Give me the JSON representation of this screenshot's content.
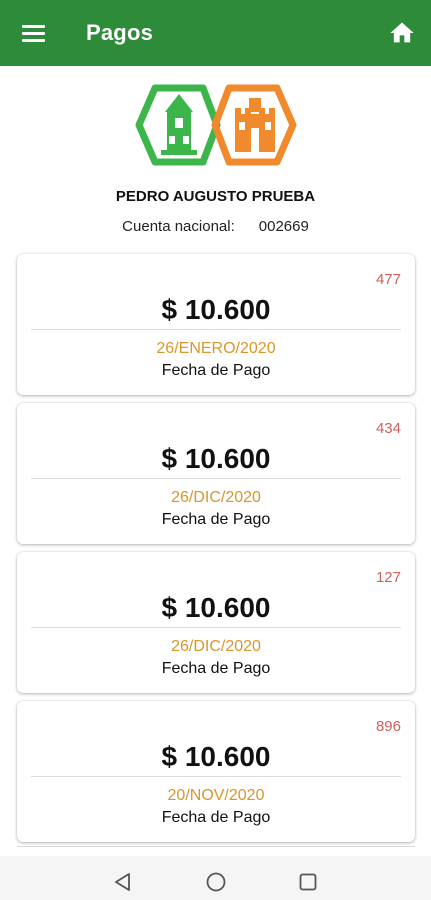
{
  "appbar": {
    "title": "Pagos",
    "menu_icon": "hamburger-menu-icon",
    "home_icon": "home-icon",
    "color": "#2e8b3a"
  },
  "logo": {
    "icon": "municipality-logo",
    "colors": [
      "#3cb54a",
      "#f08a2c"
    ]
  },
  "user": {
    "name": "PEDRO AUGUSTO PRUEBA",
    "account_label": "Cuenta nacional:",
    "account_number": "002669"
  },
  "payments": [
    {
      "id": "477",
      "amount": "$ 10.600",
      "date": "26/ENERO/2020",
      "caption": "Fecha de Pago"
    },
    {
      "id": "434",
      "amount": "$ 10.600",
      "date": "26/DIC/2020",
      "caption": "Fecha de Pago"
    },
    {
      "id": "127",
      "amount": "$ 10.600",
      "date": "26/DIC/2020",
      "caption": "Fecha de Pago"
    },
    {
      "id": "896",
      "amount": "$ 10.600",
      "date": "20/NOV/2020",
      "caption": "Fecha de Pago"
    }
  ],
  "colors": {
    "id": "#d0605a",
    "date": "#d9962a"
  },
  "navbar": {
    "icons": [
      "back-triangle-icon",
      "home-circle-icon",
      "recents-square-icon"
    ]
  }
}
